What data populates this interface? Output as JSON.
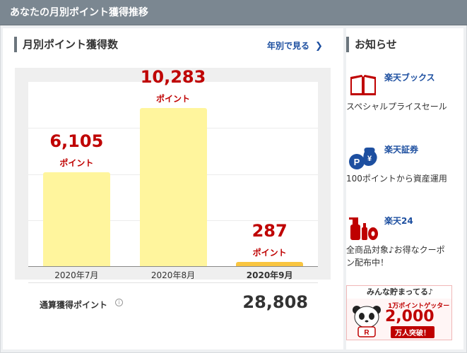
{
  "header": {
    "title": "あなたの月別ポイント獲得推移"
  },
  "monthly": {
    "section_title": "月別ポイント獲得数",
    "yearly_link": "年別で見る",
    "total_label": "通算獲得ポイント",
    "total_value": "28,808"
  },
  "chart_data": {
    "type": "bar",
    "categories": [
      "2020年7月",
      "2020年8月",
      "2020年9月"
    ],
    "values": [
      6105,
      10283,
      287
    ],
    "value_labels": [
      "6,105",
      "10,283",
      "287"
    ],
    "unit": "ポイント",
    "highlighted_category": "2020年9月",
    "bar_colors": [
      "#fff59d",
      "#fff59d",
      "#f9c540"
    ],
    "ylim": [
      0,
      12000
    ],
    "grid": true
  },
  "news": {
    "title": "お知らせ",
    "items": [
      {
        "service": "楽天ブックス",
        "desc": "スペシャルプライスセール",
        "icon": "book-icon"
      },
      {
        "service": "楽天証券",
        "desc": "100ポイントから資産運用",
        "icon": "money-bag-icon"
      },
      {
        "service": "楽天24",
        "desc": "全商品対象♪お得なクーポン配布中！",
        "icon": "household-goods-icon"
      }
    ]
  },
  "banner": {
    "top": "みんな貯まってる♪",
    "sub": "1万ポイントゲッター",
    "number": "2,000",
    "breakthrough": "万人突破！"
  },
  "colors": {
    "accent": "#bf0000",
    "link": "#1d4fa0",
    "header": "#7b8791"
  }
}
